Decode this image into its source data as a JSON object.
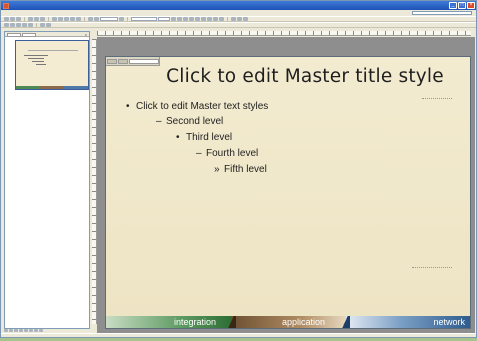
{
  "window": {
    "title": ""
  },
  "menu": {
    "items": [
      "",
      "",
      "",
      "",
      "",
      "",
      "",
      "",
      "",
      "",
      ""
    ]
  },
  "outline_pane": {
    "slide_number": ""
  },
  "slide": {
    "title": "Click to edit Master title style",
    "body_levels": [
      "Click to edit Master text styles",
      "Second level",
      "Third level",
      "Fourth level",
      "Fifth level"
    ],
    "bullets": [
      "•",
      "–",
      "•",
      "–",
      "»"
    ],
    "footer_segments": [
      "integration",
      "application",
      "network"
    ]
  },
  "status": {
    "text": ""
  },
  "colors": {
    "slide_background": "#f3ebd0",
    "integration": "#2d6e33",
    "application": "#6d5133",
    "network": "#2e5c8e",
    "titlebar": "#1e52b8"
  },
  "icons": [
    "app-icon",
    "minimize-icon",
    "maximize-icon",
    "close-icon"
  ]
}
